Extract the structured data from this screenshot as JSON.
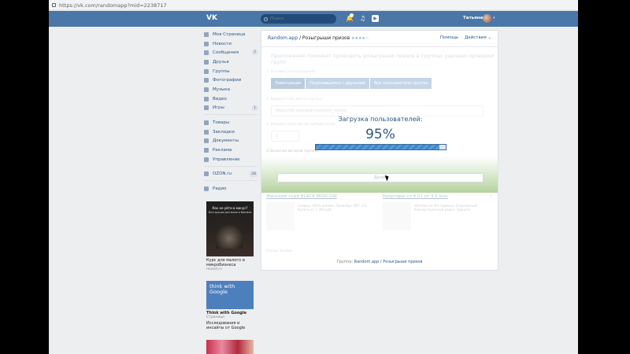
{
  "browser": {
    "url": "https://vk.com/randomapp?mid=2238717"
  },
  "header": {
    "logo": "VK",
    "search_placeholder": "Поиск",
    "user_name": "Татьяна"
  },
  "sidebar": {
    "items": [
      {
        "label": "Моя Страница",
        "count": ""
      },
      {
        "label": "Новости",
        "count": ""
      },
      {
        "label": "Сообщения",
        "count": "2"
      },
      {
        "label": "Друзья",
        "count": ""
      },
      {
        "label": "Группы",
        "count": ""
      },
      {
        "label": "Фотографии",
        "count": ""
      },
      {
        "label": "Музыка",
        "count": ""
      },
      {
        "label": "Видео",
        "count": ""
      },
      {
        "label": "Игры",
        "count": "1"
      }
    ],
    "items2": [
      {
        "label": "Товары"
      },
      {
        "label": "Закладки"
      },
      {
        "label": "Документы"
      },
      {
        "label": "Реклама"
      },
      {
        "label": "Управление"
      }
    ],
    "ozon": {
      "label": "OZON.ru",
      "count": "28"
    },
    "radio": {
      "label": "Радио"
    }
  },
  "ads": [
    {
      "img_title": "Как не уйти в минус?",
      "img_sub": "Инструкция для малого бизнеса",
      "title": "Курс для малого и микробизнеса",
      "source": "mixed.ru"
    },
    {
      "img_text": "think with Google",
      "title": "Think with Google",
      "type": "Страница",
      "desc": "Исследования и инсайты от Google"
    }
  ],
  "app": {
    "title_app": "Random.app",
    "title_sep": " / ",
    "title_page": "Розыгрыши призов",
    "stars": "★★★★☆",
    "nav": [
      "Помощь",
      "Действия ⌄"
    ],
    "intro": "Приложение поможет проводить розыгрыши призов в группах удачная проверки групп",
    "label_mode": "1. Условия розыгрыша(ей)",
    "tabs": [
      "Лайкнувшие",
      "Поделившиеся с друзьями",
      "Все пользователи группы"
    ],
    "label_url": "2. Введите URL поста группы:",
    "url_value": "https://vk.com/wall-nnnnnnn_nnnnn",
    "label_count": "3. Введите количество победителей:",
    "count_value": "1",
    "check_label": "Включая авторов группы",
    "button_label": "Далее",
    "loading_title": "Загрузка пользователей:",
    "loading_percent": "95%",
    "progress": 0.95,
    "cards": [
      {
        "title": "Женский худи BLACK MOSCOW",
        "desc": "Скидка -100% онлайн. Прайсбук ЛИТ. 3-6. Купить от 3 399 руб."
      },
      {
        "title": "Квартиры от 4.01 от 3.5 млн",
        "desc": "Ипотека от 4% годовых. Отделанный благоустроенный район. Звоните."
      }
    ],
    "footer_small": "Новые Заявки",
    "group_prefix": "Группа: ",
    "group_link": "Random.app / Розыгрыши призов"
  }
}
